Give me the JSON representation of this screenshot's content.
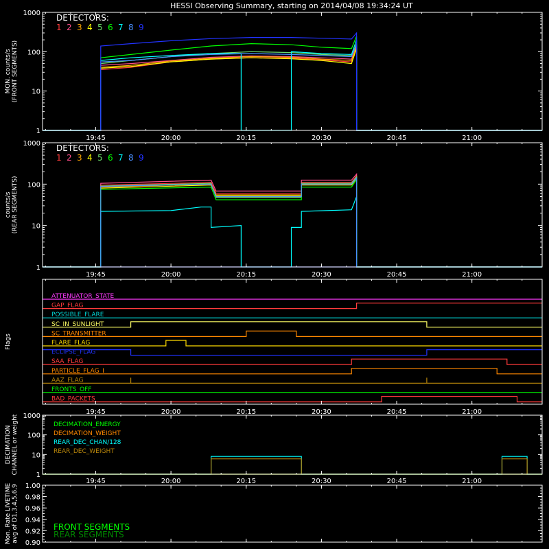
{
  "title": "HESSI Observing Summary, starting on 2014/04/08 19:34:24 UT",
  "colors": {
    "background": "#000000",
    "axes": "#ffffff",
    "det": [
      "#ff3b3b",
      "#ff4d8a",
      "#ffa500",
      "#ffff00",
      "#6bdc6b",
      "#00ff00",
      "#00ffff",
      "#4a90ff",
      "#2233ff"
    ]
  },
  "time_axis": {
    "start": "19:34:24",
    "end": "21:14",
    "ticks": [
      "19:45",
      "20:00",
      "20:15",
      "20:30",
      "20:45",
      "21:00"
    ]
  },
  "chart_data": [
    {
      "type": "line",
      "panel": "front",
      "ylabel": "MON. counts/s\n(FRONT SEGMENTS)",
      "ylog": true,
      "ylim": [
        1,
        1000
      ],
      "ytick_labels": [
        "1",
        "10",
        "100",
        "1000"
      ],
      "legend_title": "DETECTORS:",
      "legend_numbers": [
        "1",
        "2",
        "3",
        "4",
        "5",
        "6",
        "7",
        "8",
        "9"
      ],
      "series": [
        {
          "name": "1",
          "color": "#ff3b3b",
          "x": [
            "19:34:24",
            "19:46",
            "19:46",
            "19:52",
            "20:00",
            "20:08",
            "20:16",
            "20:24",
            "20:30",
            "20:36",
            "20:37",
            "20:37",
            "21:14"
          ],
          "y": [
            1,
            1,
            35,
            40,
            55,
            65,
            70,
            68,
            62,
            55,
            150,
            1,
            1
          ]
        },
        {
          "name": "2",
          "color": "#ff4d8a",
          "x": [
            "19:34:24",
            "19:46",
            "19:46",
            "19:52",
            "20:00",
            "20:08",
            "20:16",
            "20:24",
            "20:30",
            "20:36",
            "20:37",
            "20:37",
            "21:14"
          ],
          "y": [
            1,
            1,
            45,
            50,
            60,
            72,
            78,
            75,
            70,
            65,
            140,
            1,
            1
          ]
        },
        {
          "name": "3",
          "color": "#ffa500",
          "x": [
            "19:34:24",
            "19:46",
            "19:46",
            "19:52",
            "20:00",
            "20:08",
            "20:16",
            "20:24",
            "20:30",
            "20:36",
            "20:37",
            "20:37",
            "21:14"
          ],
          "y": [
            1,
            1,
            40,
            45,
            58,
            68,
            75,
            72,
            65,
            60,
            130,
            1,
            1
          ]
        },
        {
          "name": "4",
          "color": "#ffff00",
          "x": [
            "19:34:24",
            "19:46",
            "19:46",
            "19:52",
            "20:00",
            "20:08",
            "20:16",
            "20:24",
            "20:30",
            "20:36",
            "20:37",
            "20:37",
            "21:14"
          ],
          "y": [
            1,
            1,
            38,
            42,
            55,
            65,
            70,
            66,
            60,
            50,
            120,
            1,
            1
          ]
        },
        {
          "name": "5",
          "color": "#6bdc6b",
          "x": [
            "19:34:24",
            "19:46",
            "19:46",
            "19:52",
            "20:00",
            "20:08",
            "20:16",
            "20:24",
            "20:30",
            "20:36",
            "20:37",
            "20:37",
            "21:14"
          ],
          "y": [
            1,
            1,
            50,
            60,
            75,
            90,
            100,
            95,
            85,
            80,
            160,
            1,
            1
          ]
        },
        {
          "name": "6",
          "color": "#00ff00",
          "x": [
            "19:34:24",
            "19:46",
            "19:46",
            "19:52",
            "20:00",
            "20:08",
            "20:16",
            "20:24",
            "20:30",
            "20:36",
            "20:37",
            "20:37",
            "21:14"
          ],
          "y": [
            1,
            1,
            70,
            85,
            110,
            140,
            160,
            150,
            130,
            120,
            250,
            1,
            1
          ]
        },
        {
          "name": "7",
          "color": "#00ffff",
          "x": [
            "19:34:24",
            "19:46",
            "19:46",
            "19:52",
            "20:00",
            "20:08",
            "20:14",
            "20:14",
            "20:24",
            "20:24",
            "20:30",
            "20:36",
            "20:37",
            "20:37",
            "21:14"
          ],
          "y": [
            1,
            1,
            60,
            70,
            80,
            90,
            90,
            1,
            1,
            100,
            90,
            85,
            200,
            1,
            1
          ]
        },
        {
          "name": "8",
          "color": "#4a90ff",
          "x": [
            "19:34:24",
            "19:46",
            "19:46",
            "19:52",
            "20:00",
            "20:08",
            "20:16",
            "20:24",
            "20:30",
            "20:36",
            "20:37",
            "20:37",
            "21:14"
          ],
          "y": [
            1,
            1,
            55,
            60,
            75,
            85,
            90,
            85,
            80,
            75,
            150,
            1,
            1
          ]
        },
        {
          "name": "9",
          "color": "#2233ff",
          "x": [
            "19:34:24",
            "19:46",
            "19:46",
            "19:52",
            "20:00",
            "20:08",
            "20:16",
            "20:24",
            "20:30",
            "20:36",
            "20:37",
            "20:37",
            "21:14"
          ],
          "y": [
            1,
            1,
            140,
            160,
            190,
            215,
            230,
            230,
            220,
            210,
            300,
            1,
            1
          ]
        }
      ]
    },
    {
      "type": "line",
      "panel": "rear",
      "ylabel": "counts/s\n(REAR SEGMENTS)",
      "ylog": true,
      "ylim": [
        1,
        1000
      ],
      "ytick_labels": [
        "1",
        "10",
        "100",
        "1000"
      ],
      "legend_title": "DETECTORS:",
      "legend_numbers": [
        "1",
        "2",
        "3",
        "4",
        "5",
        "6",
        "7",
        "8",
        "9"
      ],
      "series": [
        {
          "name": "1",
          "color": "#ff3b3b",
          "x": [
            "19:34:24",
            "19:46",
            "19:46",
            "20:08",
            "20:09",
            "20:26",
            "20:26",
            "20:36",
            "20:37",
            "20:37",
            "21:14"
          ],
          "y": [
            1,
            1,
            95,
            110,
            60,
            60,
            110,
            110,
            160,
            1,
            1
          ]
        },
        {
          "name": "2",
          "color": "#ff4d8a",
          "x": [
            "19:34:24",
            "19:46",
            "19:46",
            "20:08",
            "20:09",
            "20:26",
            "20:26",
            "20:36",
            "20:37",
            "20:37",
            "21:14"
          ],
          "y": [
            1,
            1,
            105,
            125,
            68,
            68,
            125,
            125,
            175,
            1,
            1
          ]
        },
        {
          "name": "3",
          "color": "#ffa500",
          "x": [
            "19:34:24",
            "19:46",
            "19:46",
            "20:08",
            "20:09",
            "20:26",
            "20:26",
            "20:36",
            "20:37",
            "20:37",
            "21:14"
          ],
          "y": [
            1,
            1,
            85,
            100,
            55,
            55,
            100,
            100,
            150,
            1,
            1
          ]
        },
        {
          "name": "4",
          "color": "#ffff00",
          "x": [
            "19:34:24",
            "19:46",
            "19:46",
            "20:08",
            "20:09",
            "20:26",
            "20:26",
            "20:36",
            "20:37",
            "20:37",
            "21:14"
          ],
          "y": [
            1,
            1,
            80,
            95,
            52,
            52,
            95,
            95,
            140,
            1,
            1
          ]
        },
        {
          "name": "5",
          "color": "#6bdc6b",
          "x": [
            "19:34:24",
            "19:46",
            "19:46",
            "20:08",
            "20:09",
            "20:26",
            "20:26",
            "20:36",
            "20:37",
            "20:37",
            "21:14"
          ],
          "y": [
            1,
            1,
            90,
            105,
            48,
            48,
            105,
            105,
            150,
            1,
            1
          ]
        },
        {
          "name": "6",
          "color": "#00ff00",
          "x": [
            "19:34:24",
            "19:46",
            "19:46",
            "20:08",
            "20:09",
            "20:26",
            "20:26",
            "20:36",
            "20:37",
            "20:37",
            "21:14"
          ],
          "y": [
            1,
            1,
            75,
            85,
            42,
            42,
            85,
            85,
            130,
            1,
            1
          ]
        },
        {
          "name": "7",
          "color": "#00ffff",
          "x": [
            "19:34:24",
            "19:46",
            "19:46",
            "20:00",
            "20:06",
            "20:08",
            "20:08",
            "20:14",
            "20:14",
            "20:24",
            "20:24",
            "20:26",
            "20:26",
            "20:36",
            "20:37",
            "20:37",
            "21:14"
          ],
          "y": [
            1,
            1,
            22,
            23,
            28,
            28,
            9,
            10,
            1,
            1,
            9,
            9,
            22,
            24,
            50,
            1,
            1
          ]
        },
        {
          "name": "8",
          "color": "#4a90ff",
          "x": [
            "19:34:24",
            "19:46",
            "19:46",
            "20:08",
            "20:09",
            "20:26",
            "20:26",
            "20:36",
            "20:37",
            "20:37",
            "21:14"
          ],
          "y": [
            1,
            1,
            88,
            100,
            50,
            50,
            100,
            100,
            140,
            1,
            1
          ]
        },
        {
          "name": "9",
          "color": "#2233ff",
          "x": [
            "19:34:24",
            "21:14"
          ],
          "y": [
            1,
            1
          ]
        }
      ]
    },
    {
      "type": "line",
      "panel": "flags",
      "ylabel": "Flags",
      "flags": [
        {
          "name": "ATTENUATOR_STATE",
          "color": "#ff3bff",
          "x": [
            "19:34:24",
            "21:14"
          ],
          "y": [
            0,
            0
          ]
        },
        {
          "name": "GAP_FLAG",
          "color": "#ff3b3b",
          "x": [
            "19:34:24",
            "20:37",
            "20:37",
            "21:14"
          ],
          "y": [
            0,
            0,
            1,
            1
          ]
        },
        {
          "name": "POSSIBLE_FLARE",
          "color": "#00dddd",
          "x": [
            "19:34:24",
            "21:14"
          ],
          "y": [
            0,
            0
          ]
        },
        {
          "name": "SC_IN_SUNLIGHT",
          "color": "#ffff66",
          "x": [
            "19:34:24",
            "19:52",
            "19:52",
            "20:51",
            "20:51",
            "21:14"
          ],
          "y": [
            0,
            0,
            1,
            1,
            0,
            0
          ]
        },
        {
          "name": "SC_TRANSMITTER",
          "color": "#ff8800",
          "x": [
            "19:34:24",
            "20:15",
            "20:15",
            "20:25",
            "20:25",
            "21:14"
          ],
          "y": [
            0,
            0,
            1,
            1,
            0,
            0
          ]
        },
        {
          "name": "FLARE_FLAG",
          "color": "#ffdd00",
          "x": [
            "19:34:24",
            "19:59",
            "19:59",
            "20:03",
            "20:03",
            "21:14"
          ],
          "y": [
            0,
            0,
            1,
            1,
            0,
            0
          ]
        },
        {
          "name": "ECLIPSE_FLAG",
          "color": "#2233ff",
          "x": [
            "19:34:24",
            "19:52",
            "19:52",
            "20:51",
            "20:51",
            "21:14"
          ],
          "y": [
            1,
            1,
            0,
            0,
            1,
            1
          ]
        },
        {
          "name": "SAA_FLAG",
          "color": "#ff3b3b",
          "x": [
            "19:34:24",
            "20:36",
            "20:36",
            "21:07",
            "21:07",
            "21:14"
          ],
          "y": [
            0,
            0,
            1,
            1,
            0,
            0
          ]
        },
        {
          "name": "PARTICLE_FLAG_I",
          "color": "#ff8800",
          "x": [
            "19:34:24",
            "20:36",
            "20:36",
            "21:05",
            "21:05",
            "21:14"
          ],
          "y": [
            0,
            0,
            1,
            1,
            0,
            0
          ]
        },
        {
          "name": "AAZ_FLAG",
          "color": "#b8860b",
          "x": [
            "19:34:24",
            "19:52",
            "19:52",
            "19:52",
            "20:51",
            "20:51",
            "20:51",
            "21:14"
          ],
          "y": [
            0,
            0,
            1,
            0,
            0,
            1,
            0,
            0
          ]
        },
        {
          "name": "FRONTS_OFF",
          "color": "#00ff00",
          "x": [
            "19:34:24",
            "21:14"
          ],
          "y": [
            0,
            0
          ]
        },
        {
          "name": "BAD_PACKETS",
          "color": "#ff3b3b",
          "x": [
            "19:34:24",
            "20:42",
            "20:42",
            "21:09",
            "21:09",
            "21:14"
          ],
          "y": [
            0,
            0,
            1,
            1,
            0,
            0
          ]
        }
      ]
    },
    {
      "type": "line",
      "panel": "decimation",
      "ylabel": "DECIMATION\nCHANNEL or weight",
      "ylog": true,
      "ylim": [
        1,
        1000
      ],
      "ytick_labels": [
        "1",
        "10",
        "100",
        "1000"
      ],
      "series": [
        {
          "name": "DECIMATION_ENERGY",
          "color": "#00ff00",
          "x": [
            "19:34:24",
            "21:14"
          ],
          "y": [
            1,
            1
          ]
        },
        {
          "name": "DECIMATION_WEIGHT",
          "color": "#ff8800",
          "x": [
            "19:34:24",
            "21:14"
          ],
          "y": [
            1,
            1
          ]
        },
        {
          "name": "REAR_DEC_CHAN/128",
          "color": "#00ffff",
          "x": [
            "19:34:24",
            "20:08",
            "20:08",
            "20:26",
            "20:26",
            "21:06",
            "21:06",
            "21:11",
            "21:11",
            "21:14"
          ],
          "y": [
            1,
            1,
            8,
            8,
            1,
            1,
            8,
            8,
            1,
            1
          ]
        },
        {
          "name": "REAR_DEC_WEIGHT",
          "color": "#b8860b",
          "x": [
            "19:34:24",
            "20:08",
            "20:08",
            "20:26",
            "20:26",
            "21:06",
            "21:06",
            "21:11",
            "21:11",
            "21:14"
          ],
          "y": [
            1,
            1,
            6,
            6,
            1,
            1,
            6,
            6,
            1,
            1
          ]
        }
      ]
    },
    {
      "type": "line",
      "panel": "livetime",
      "ylabel": "Mon. Rate LIVETIME\navg of D1,3,4,5,6,9",
      "ylim": [
        0.9,
        1.0
      ],
      "ytick_labels": [
        "0.90",
        "0.92",
        "0.94",
        "0.96",
        "0.98",
        "1.00"
      ],
      "series": [
        {
          "name": "FRONT SEGMENTS",
          "color": "#00ff00",
          "x": [],
          "y": []
        },
        {
          "name": "REAR SEGMENTS",
          "color": "#008800",
          "x": [],
          "y": []
        }
      ]
    }
  ]
}
